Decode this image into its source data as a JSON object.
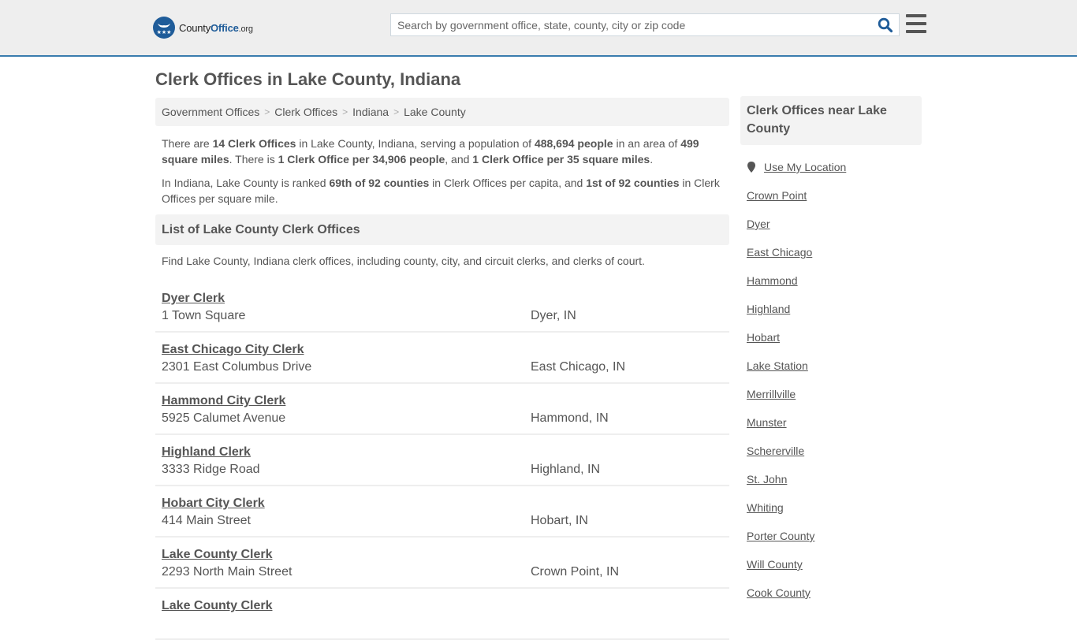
{
  "header": {
    "logo": {
      "name_part1": "County",
      "name_part2": "Office",
      "suffix": ".org"
    },
    "search": {
      "placeholder": "Search by government office, state, county, city or zip code",
      "value": ""
    }
  },
  "page": {
    "title": "Clerk Offices in Lake County, Indiana"
  },
  "breadcrumb": [
    {
      "label": "Government Offices"
    },
    {
      "label": "Clerk Offices"
    },
    {
      "label": "Indiana"
    },
    {
      "label": "Lake County"
    }
  ],
  "intro": {
    "p1": {
      "t1": "There are ",
      "b1": "14 Clerk Offices",
      "t2": " in Lake County, Indiana, serving a population of ",
      "b2": "488,694 people",
      "t3": " in an area of ",
      "b3": "499 square miles",
      "t4": ". There is ",
      "b4": "1 Clerk Office per 34,906 people",
      "t5": ", and ",
      "b5": "1 Clerk Office per 35 square miles",
      "t6": "."
    },
    "p2": {
      "t1": "In Indiana, Lake County is ranked ",
      "b1": "69th of 92 counties",
      "t2": " in Clerk Offices per capita, and ",
      "b2": "1st of 92 counties",
      "t3": " in Clerk Offices per square mile."
    }
  },
  "list": {
    "header": "List of Lake County Clerk Offices",
    "description": "Find Lake County, Indiana clerk offices, including county, city, and circuit clerks, and clerks of court.",
    "offices": [
      {
        "name": "Dyer Clerk",
        "address": "1 Town Square",
        "city": "Dyer, IN"
      },
      {
        "name": "East Chicago City Clerk",
        "address": "2301 East Columbus Drive",
        "city": "East Chicago, IN"
      },
      {
        "name": "Hammond City Clerk",
        "address": "5925 Calumet Avenue",
        "city": "Hammond, IN"
      },
      {
        "name": "Highland Clerk",
        "address": "3333 Ridge Road",
        "city": "Highland, IN"
      },
      {
        "name": "Hobart City Clerk",
        "address": "414 Main Street",
        "city": "Hobart, IN"
      },
      {
        "name": "Lake County Clerk",
        "address": "2293 North Main Street",
        "city": "Crown Point, IN"
      },
      {
        "name": "Lake County Clerk",
        "address": "",
        "city": ""
      }
    ]
  },
  "sidebar": {
    "title": "Clerk Offices near Lake County",
    "use_location": "Use My Location",
    "links": [
      "Crown Point",
      "Dyer",
      "East Chicago",
      "Hammond",
      "Highland",
      "Hobart",
      "Lake Station",
      "Merrillville",
      "Munster",
      "Schererville",
      "St. John",
      "Whiting",
      "Porter County",
      "Will County",
      "Cook County"
    ]
  },
  "colors": {
    "brand_blue": "#1f5c99",
    "header_border": "#3a7cae",
    "text": "#555555",
    "panel_bg": "#f3f3f3"
  }
}
